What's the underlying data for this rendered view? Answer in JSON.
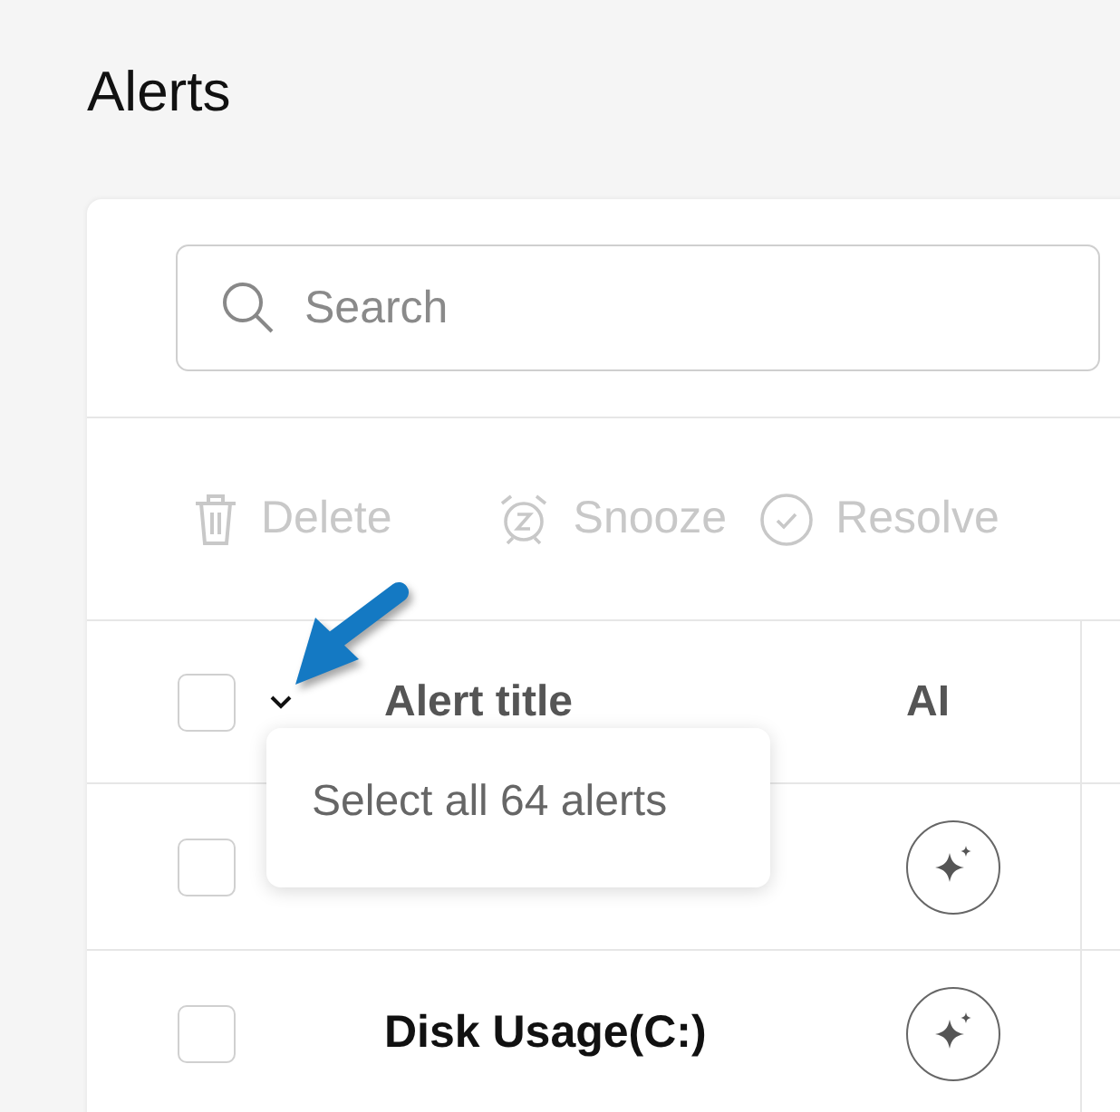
{
  "page": {
    "title": "Alerts"
  },
  "search": {
    "placeholder": "Search"
  },
  "toolbar": [
    {
      "label": "Delete",
      "kind": "delete",
      "disabled": true
    },
    {
      "label": "Snooze",
      "kind": "snooze",
      "disabled": true
    },
    {
      "label": "Resolve",
      "kind": "resolve",
      "disabled": true
    }
  ],
  "table": {
    "columns": [
      "Alert title",
      "AI"
    ],
    "header_checked": false,
    "rows": [
      {
        "checked": false
      },
      {
        "title": "Disk Usage(C:)",
        "checked": false
      }
    ]
  },
  "select_menu": {
    "items": [
      "Select all 64 alerts"
    ]
  }
}
